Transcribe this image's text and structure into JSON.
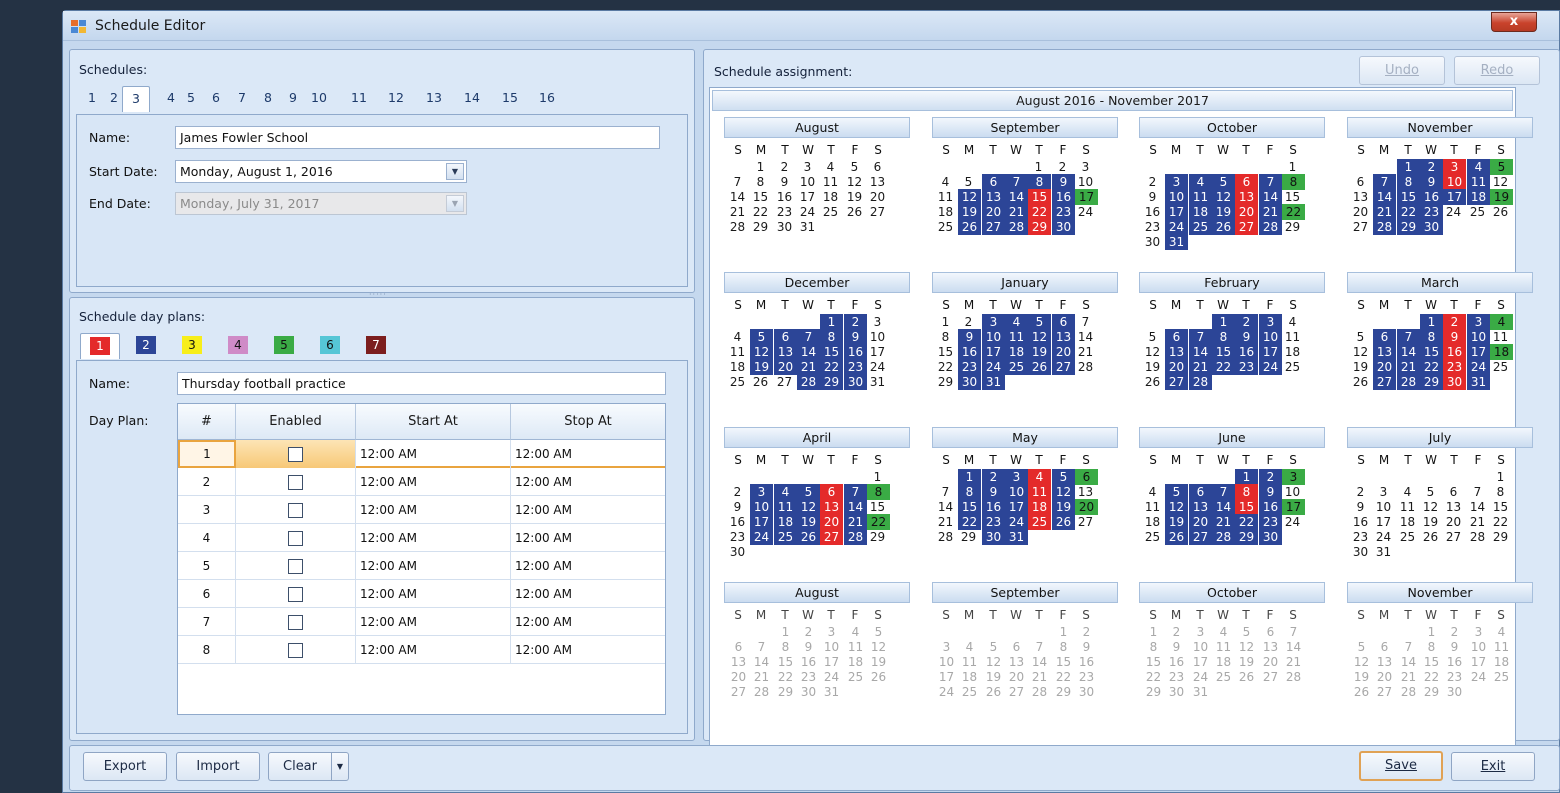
{
  "window": {
    "title": "Schedule Editor",
    "close_label": "x"
  },
  "schedules": {
    "label": "Schedules:",
    "tabs": [
      "1",
      "2",
      "3",
      "4",
      "5",
      "6",
      "7",
      "8",
      "9",
      "10",
      "11",
      "12",
      "13",
      "14",
      "15",
      "16"
    ],
    "active_tab": "3",
    "name_label": "Name:",
    "name_value": "James Fowler School",
    "start_label": "Start Date:",
    "start_value": "Monday, August 1, 2016",
    "end_label": "End Date:",
    "end_value": "Monday, July 31, 2017"
  },
  "day_plans": {
    "label": "Schedule day plans:",
    "tabs": [
      {
        "label": "1",
        "color": "#e42a2a",
        "text": "#ffffff"
      },
      {
        "label": "2",
        "color": "#2c4597",
        "text": "#ffffff"
      },
      {
        "label": "3",
        "color": "#f7ee1a",
        "text": "#111111"
      },
      {
        "label": "4",
        "color": "#cf8bc7",
        "text": "#111111"
      },
      {
        "label": "5",
        "color": "#3aab45",
        "text": "#111111"
      },
      {
        "label": "6",
        "color": "#56c6d6",
        "text": "#111111"
      },
      {
        "label": "7",
        "color": "#7c1e1e",
        "text": "#ffffff"
      }
    ],
    "active_tab": "1",
    "name_label": "Name:",
    "name_value": "Thursday football practice",
    "dayplan_label": "Day Plan:",
    "columns": [
      "#",
      "Enabled",
      "Start At",
      "Stop At"
    ],
    "rows": [
      {
        "num": "1",
        "start": "12:00 AM",
        "stop": "12:00 AM"
      },
      {
        "num": "2",
        "start": "12:00 AM",
        "stop": "12:00 AM"
      },
      {
        "num": "3",
        "start": "12:00 AM",
        "stop": "12:00 AM"
      },
      {
        "num": "4",
        "start": "12:00 AM",
        "stop": "12:00 AM"
      },
      {
        "num": "5",
        "start": "12:00 AM",
        "stop": "12:00 AM"
      },
      {
        "num": "6",
        "start": "12:00 AM",
        "stop": "12:00 AM"
      },
      {
        "num": "7",
        "start": "12:00 AM",
        "stop": "12:00 AM"
      },
      {
        "num": "8",
        "start": "12:00 AM",
        "stop": "12:00 AM"
      }
    ]
  },
  "assignment": {
    "label": "Schedule assignment:",
    "undo_label": "Undo",
    "redo_label": "Redo",
    "range_title": "August 2016 - November 2017",
    "dow": [
      "S",
      "M",
      "T",
      "W",
      "T",
      "F",
      "S"
    ],
    "months": [
      {
        "name": "August",
        "start": 1,
        "days": 31,
        "gray": false,
        "blue": [],
        "red": [],
        "green": []
      },
      {
        "name": "September",
        "start": 4,
        "days": 30,
        "gray": false,
        "blue": [
          6,
          7,
          8,
          9,
          12,
          13,
          14,
          16,
          19,
          20,
          21,
          23,
          26,
          27,
          28,
          30
        ],
        "red": [
          15,
          22,
          29
        ],
        "green": [
          17
        ]
      },
      {
        "name": "October",
        "start": 6,
        "days": 31,
        "gray": false,
        "blue": [
          3,
          4,
          5,
          7,
          10,
          11,
          12,
          14,
          17,
          18,
          19,
          21,
          24,
          25,
          26,
          28,
          31
        ],
        "red": [
          6,
          13,
          20,
          27
        ],
        "green": [
          8,
          22
        ]
      },
      {
        "name": "November",
        "start": 2,
        "days": 30,
        "gray": false,
        "blue": [
          1,
          2,
          4,
          7,
          8,
          9,
          11,
          14,
          15,
          16,
          17,
          18,
          21,
          22,
          23,
          28,
          29,
          30
        ],
        "red": [
          3,
          10
        ],
        "green": [
          5,
          19
        ]
      },
      {
        "name": "December",
        "start": 4,
        "days": 31,
        "gray": false,
        "blue": [
          1,
          2,
          5,
          6,
          7,
          8,
          9,
          12,
          13,
          14,
          15,
          16,
          19,
          20,
          21,
          22,
          23,
          28,
          29,
          30
        ],
        "red": [],
        "green": []
      },
      {
        "name": "January",
        "start": 0,
        "days": 31,
        "gray": false,
        "blue": [
          3,
          4,
          5,
          6,
          9,
          10,
          11,
          12,
          13,
          16,
          17,
          18,
          19,
          20,
          23,
          24,
          25,
          26,
          27,
          30,
          31
        ],
        "red": [],
        "green": []
      },
      {
        "name": "February",
        "start": 3,
        "days": 28,
        "gray": false,
        "blue": [
          1,
          2,
          3,
          6,
          7,
          8,
          9,
          10,
          13,
          14,
          15,
          16,
          17,
          20,
          21,
          22,
          23,
          24,
          27,
          28
        ],
        "red": [],
        "green": []
      },
      {
        "name": "March",
        "start": 3,
        "days": 31,
        "gray": false,
        "blue": [
          1,
          3,
          6,
          7,
          8,
          10,
          13,
          14,
          15,
          17,
          20,
          21,
          22,
          24,
          27,
          28,
          29,
          31
        ],
        "red": [
          2,
          9,
          16,
          23,
          30
        ],
        "green": [
          4,
          18
        ]
      },
      {
        "name": "April",
        "start": 6,
        "days": 30,
        "gray": false,
        "blue": [
          3,
          4,
          5,
          7,
          10,
          11,
          12,
          14,
          17,
          18,
          19,
          21,
          24,
          25,
          26,
          28
        ],
        "red": [
          6,
          13,
          20,
          27
        ],
        "green": [
          8,
          22
        ]
      },
      {
        "name": "May",
        "start": 1,
        "days": 31,
        "gray": false,
        "blue": [
          1,
          2,
          3,
          5,
          8,
          9,
          10,
          12,
          15,
          16,
          17,
          19,
          22,
          23,
          24,
          26,
          30,
          31
        ],
        "red": [
          4,
          11,
          18,
          25
        ],
        "green": [
          6,
          20
        ]
      },
      {
        "name": "June",
        "start": 4,
        "days": 30,
        "gray": false,
        "blue": [
          1,
          2,
          5,
          6,
          7,
          9,
          12,
          13,
          14,
          16,
          19,
          20,
          21,
          22,
          23,
          26,
          27,
          28,
          29,
          30
        ],
        "red": [
          8,
          15
        ],
        "green": [
          3,
          17
        ]
      },
      {
        "name": "July",
        "start": 6,
        "days": 31,
        "gray": false,
        "blue": [],
        "red": [],
        "green": []
      },
      {
        "name": "August",
        "start": 2,
        "days": 31,
        "gray": true,
        "blue": [],
        "red": [],
        "green": []
      },
      {
        "name": "September",
        "start": 5,
        "days": 30,
        "gray": true,
        "blue": [],
        "red": [],
        "green": []
      },
      {
        "name": "October",
        "start": 0,
        "days": 31,
        "gray": true,
        "blue": [],
        "red": [],
        "green": []
      },
      {
        "name": "November",
        "start": 3,
        "days": 30,
        "gray": true,
        "blue": [],
        "red": [],
        "green": []
      }
    ]
  },
  "footer": {
    "export_label": "Export",
    "import_label": "Import",
    "clear_label": "Clear",
    "save_label": "Save",
    "exit_label": "Exit"
  }
}
